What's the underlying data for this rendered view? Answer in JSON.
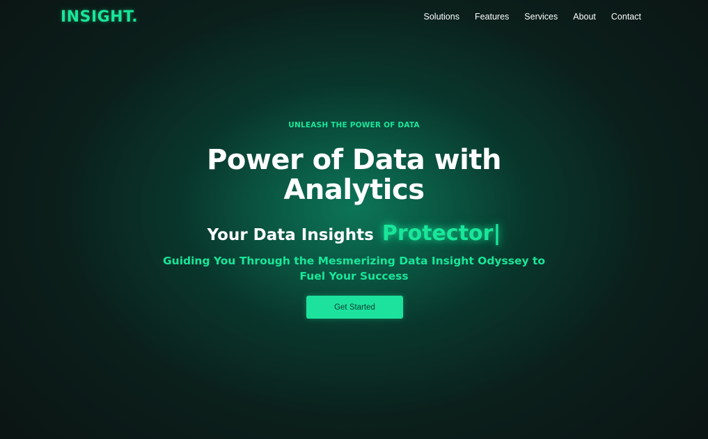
{
  "brand": {
    "logo": "INSIGHT."
  },
  "nav": {
    "items": [
      "Solutions",
      "Features",
      "Services",
      "About",
      "Contact"
    ]
  },
  "hero": {
    "eyebrow": "UNLEASH THE POWER OF DATA",
    "headline_line1": "Power of Data with",
    "headline_line2": "Analytics",
    "tagline_static": "Your Data Insights",
    "tagline_typed": "Protector|",
    "subtitle_line1": "Guiding You Through the Mesmerizing Data Insight Odyssey to",
    "subtitle_line2": "Fuel Your Success",
    "cta_label": "Get Started"
  },
  "colors": {
    "accent": "#19e69a",
    "background": "#0b1413",
    "glow": "#0c785a",
    "button": "#1de29e"
  }
}
